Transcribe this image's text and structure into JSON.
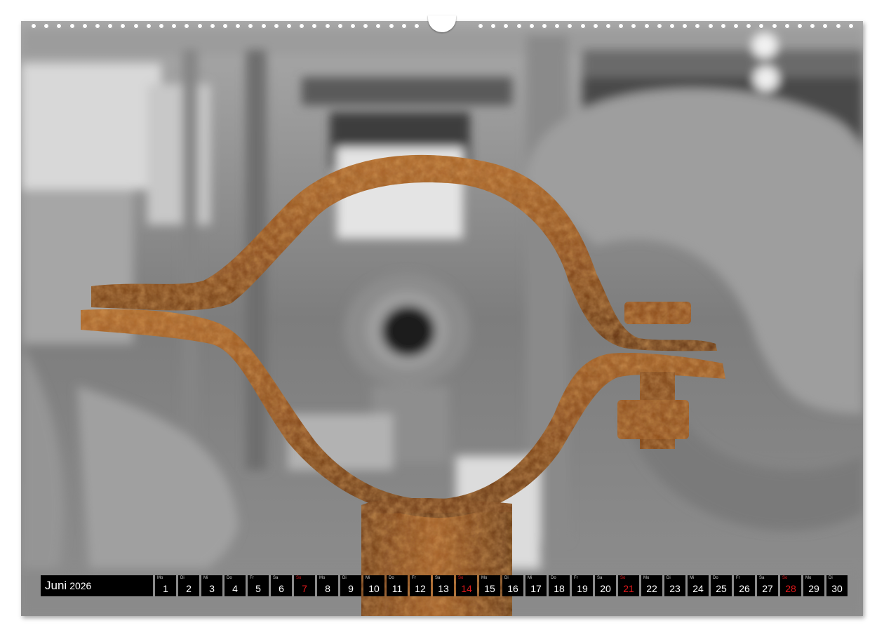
{
  "calendar": {
    "month": "Juni",
    "year": "2026",
    "days": [
      {
        "wd": "Mo",
        "num": "1",
        "sun": false
      },
      {
        "wd": "Di",
        "num": "2",
        "sun": false
      },
      {
        "wd": "Mi",
        "num": "3",
        "sun": false
      },
      {
        "wd": "Do",
        "num": "4",
        "sun": false
      },
      {
        "wd": "Fr",
        "num": "5",
        "sun": false
      },
      {
        "wd": "Sa",
        "num": "6",
        "sun": false
      },
      {
        "wd": "So",
        "num": "7",
        "sun": true
      },
      {
        "wd": "Mo",
        "num": "8",
        "sun": false
      },
      {
        "wd": "Di",
        "num": "9",
        "sun": false
      },
      {
        "wd": "Mi",
        "num": "10",
        "sun": false
      },
      {
        "wd": "Do",
        "num": "11",
        "sun": false
      },
      {
        "wd": "Fr",
        "num": "12",
        "sun": false
      },
      {
        "wd": "Sa",
        "num": "13",
        "sun": false
      },
      {
        "wd": "So",
        "num": "14",
        "sun": true
      },
      {
        "wd": "Mo",
        "num": "15",
        "sun": false
      },
      {
        "wd": "Di",
        "num": "16",
        "sun": false
      },
      {
        "wd": "Mi",
        "num": "17",
        "sun": false
      },
      {
        "wd": "Do",
        "num": "18",
        "sun": false
      },
      {
        "wd": "Fr",
        "num": "19",
        "sun": false
      },
      {
        "wd": "Sa",
        "num": "20",
        "sun": false
      },
      {
        "wd": "So",
        "num": "21",
        "sun": true
      },
      {
        "wd": "Mo",
        "num": "22",
        "sun": false
      },
      {
        "wd": "Di",
        "num": "23",
        "sun": false
      },
      {
        "wd": "Mi",
        "num": "24",
        "sun": false
      },
      {
        "wd": "Do",
        "num": "25",
        "sun": false
      },
      {
        "wd": "Fr",
        "num": "26",
        "sun": false
      },
      {
        "wd": "Sa",
        "num": "27",
        "sun": false
      },
      {
        "wd": "So",
        "num": "28",
        "sun": true
      },
      {
        "wd": "Mo",
        "num": "29",
        "sun": false
      },
      {
        "wd": "Di",
        "num": "30",
        "sun": false
      }
    ]
  },
  "colors": {
    "calendar_bg": "#000000",
    "sunday_red": "#e0181b",
    "rust": "#8a4a1c"
  }
}
